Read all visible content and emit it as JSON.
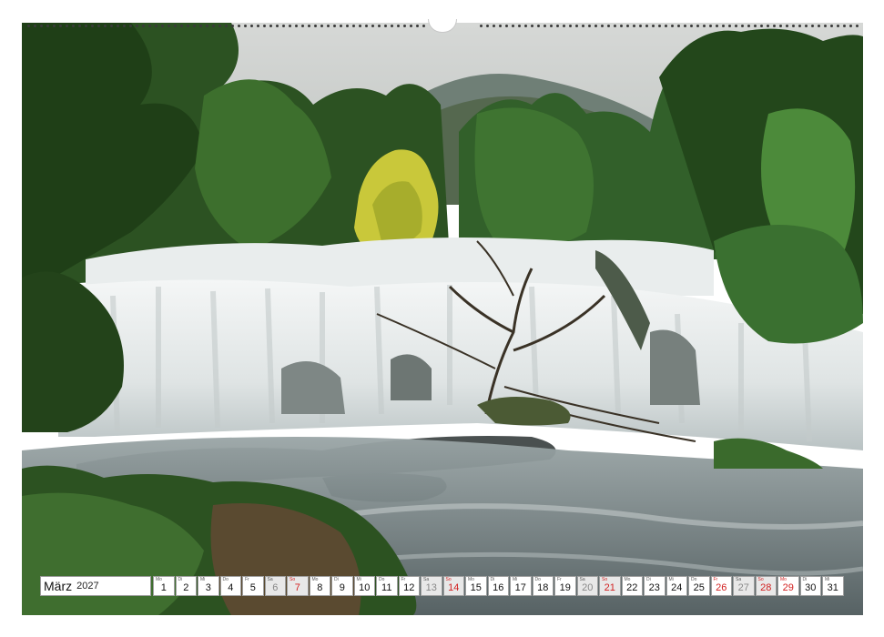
{
  "calendar": {
    "month": "März",
    "year": "2027",
    "colors": {
      "sunday": "#d22020",
      "saturday": "#888888",
      "text": "#111111"
    },
    "days": [
      {
        "wd": "Mo",
        "d": "1",
        "type": "weekday"
      },
      {
        "wd": "Di",
        "d": "2",
        "type": "weekday"
      },
      {
        "wd": "Mi",
        "d": "3",
        "type": "weekday"
      },
      {
        "wd": "Do",
        "d": "4",
        "type": "weekday"
      },
      {
        "wd": "Fr",
        "d": "5",
        "type": "weekday"
      },
      {
        "wd": "Sa",
        "d": "6",
        "type": "sat"
      },
      {
        "wd": "So",
        "d": "7",
        "type": "sun"
      },
      {
        "wd": "Mo",
        "d": "8",
        "type": "weekday"
      },
      {
        "wd": "Di",
        "d": "9",
        "type": "weekday"
      },
      {
        "wd": "Mi",
        "d": "10",
        "type": "weekday"
      },
      {
        "wd": "Do",
        "d": "11",
        "type": "weekday"
      },
      {
        "wd": "Fr",
        "d": "12",
        "type": "weekday"
      },
      {
        "wd": "Sa",
        "d": "13",
        "type": "sat"
      },
      {
        "wd": "So",
        "d": "14",
        "type": "sun"
      },
      {
        "wd": "Mo",
        "d": "15",
        "type": "weekday"
      },
      {
        "wd": "Di",
        "d": "16",
        "type": "weekday"
      },
      {
        "wd": "Mi",
        "d": "17",
        "type": "weekday"
      },
      {
        "wd": "Do",
        "d": "18",
        "type": "weekday"
      },
      {
        "wd": "Fr",
        "d": "19",
        "type": "weekday"
      },
      {
        "wd": "Sa",
        "d": "20",
        "type": "sat"
      },
      {
        "wd": "So",
        "d": "21",
        "type": "sun"
      },
      {
        "wd": "Mo",
        "d": "22",
        "type": "weekday"
      },
      {
        "wd": "Di",
        "d": "23",
        "type": "weekday"
      },
      {
        "wd": "Mi",
        "d": "24",
        "type": "weekday"
      },
      {
        "wd": "Do",
        "d": "25",
        "type": "weekday"
      },
      {
        "wd": "Fr",
        "d": "26",
        "type": "holiday"
      },
      {
        "wd": "Sa",
        "d": "27",
        "type": "sat"
      },
      {
        "wd": "So",
        "d": "28",
        "type": "sun"
      },
      {
        "wd": "Mo",
        "d": "29",
        "type": "holiday"
      },
      {
        "wd": "Di",
        "d": "30",
        "type": "weekday"
      },
      {
        "wd": "Mi",
        "d": "31",
        "type": "weekday"
      }
    ]
  },
  "photo": {
    "subject": "waterfall-forest",
    "colors": {
      "sky": "#cfd2d0",
      "mountain": "#6f7f76",
      "forest": "#2f5a25",
      "tree_yellow": "#c9c83a",
      "water": "#eef0f0",
      "rock": "#4a5050",
      "pool": "#5f6a6c"
    }
  }
}
